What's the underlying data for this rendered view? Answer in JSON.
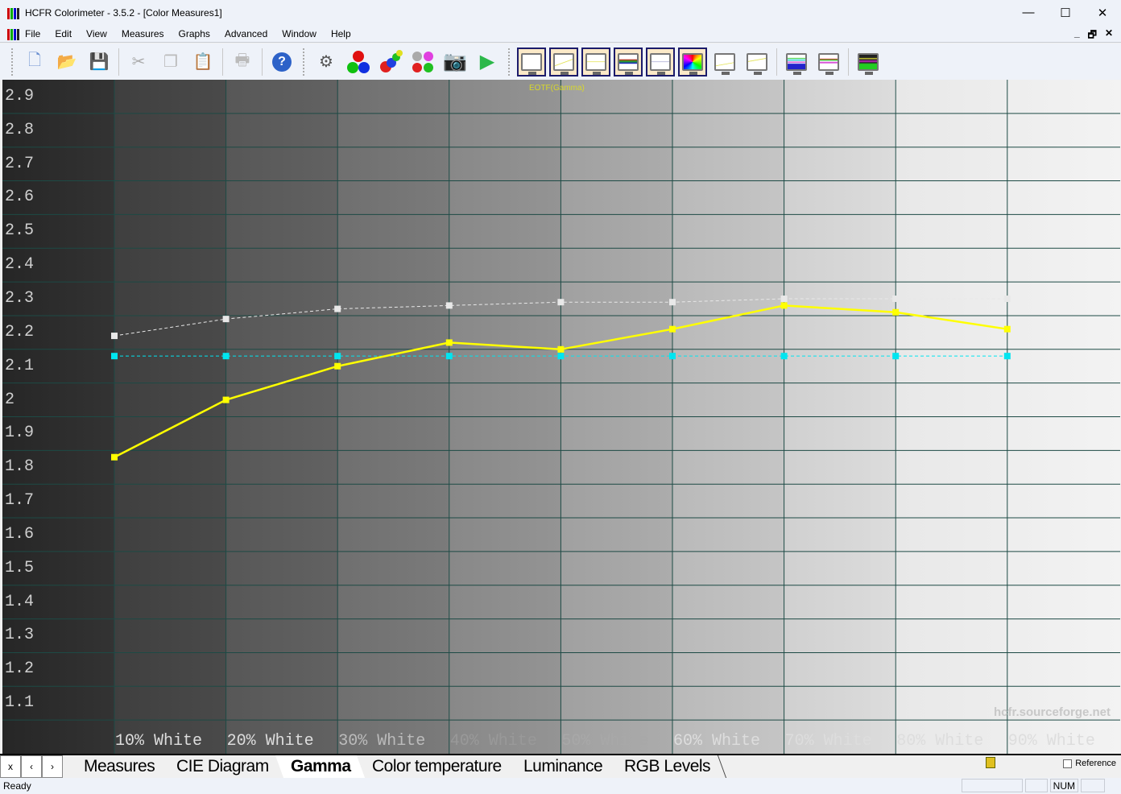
{
  "window": {
    "title": "HCFR Colorimeter - 3.5.2 - [Color Measures1]",
    "minimize": "—",
    "maximize": "☐",
    "close": "✕"
  },
  "menu": {
    "items": [
      "File",
      "Edit",
      "View",
      "Measures",
      "Graphs",
      "Advanced",
      "Window",
      "Help"
    ],
    "mdi": [
      "_",
      "🗗",
      "✕"
    ]
  },
  "toolbar": {
    "icons": [
      "new-document-icon",
      "open-folder-icon",
      "save-icon",
      "cut-icon",
      "copy-icon",
      "paste-icon",
      "print-icon",
      "help-icon",
      "probe-icon",
      "rgb-balls-icon",
      "color-balls-icon",
      "multi-balls-icon",
      "camera-icon",
      "play-icon",
      "measures-view-icon",
      "gamma-view-icon",
      "luminance-view-icon",
      "rgb-levels-view-icon",
      "color-temp-view-icon",
      "cie-view-icon",
      "near-black-view-icon",
      "near-white-view-icon",
      "saturation-view-icon",
      "saturation-shift-view-icon",
      "color-comparator-view-icon"
    ]
  },
  "chart_data": {
    "type": "line",
    "title": "EOTF(Gamma)",
    "categories": [
      "10% White",
      "20% White",
      "30% White",
      "40% White",
      "50% White",
      "60% White",
      "70% White",
      "80% White",
      "90% White"
    ],
    "ylim": [
      1.0,
      3.0
    ],
    "yticks": [
      "2.9",
      "2.8",
      "2.7",
      "2.6",
      "2.5",
      "2.4",
      "2.3",
      "2.2",
      "2.1",
      "2",
      "1.9",
      "1.8",
      "1.7",
      "1.6",
      "1.5",
      "1.4",
      "1.3",
      "1.2",
      "1.1"
    ],
    "grid": true,
    "series": [
      {
        "values": [
          1.88,
          2.05,
          2.15,
          2.22,
          2.2,
          2.26,
          2.33,
          2.31,
          2.26
        ],
        "color": "#ffff00",
        "style": "solid"
      },
      {
        "values": [
          2.18,
          2.18,
          2.18,
          2.18,
          2.18,
          2.18,
          2.18,
          2.18,
          2.18
        ],
        "color": "#00e5f0",
        "style": "dashed"
      },
      {
        "values": [
          2.24,
          2.29,
          2.32,
          2.33,
          2.34,
          2.34,
          2.35,
          2.35,
          2.35
        ],
        "color": "#e8e8e8",
        "style": "dashed"
      }
    ]
  },
  "watermark": "hcfr.sourceforge.net",
  "tabs": {
    "nav": [
      "x",
      "‹",
      "›"
    ],
    "items": [
      "Measures",
      "CIE Diagram",
      "Gamma",
      "Color temperature",
      "Luminance",
      "RGB Levels"
    ],
    "active": "Gamma",
    "reference": "Reference"
  },
  "status": {
    "text": "Ready",
    "num": "NUM"
  }
}
